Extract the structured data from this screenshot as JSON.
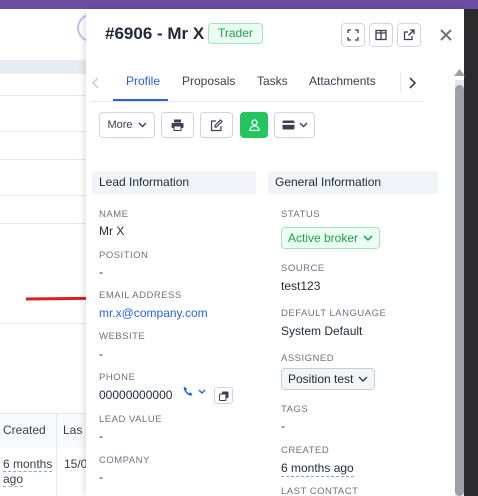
{
  "background": {
    "table_headers": [
      "Created",
      "Las"
    ],
    "created_cell": "6 months ago",
    "last_cell": "15/0"
  },
  "lead": {
    "title": "#6906 - Mr X",
    "badge": "Trader"
  },
  "tabs": [
    "Profile",
    "Proposals",
    "Tasks",
    "Attachments"
  ],
  "active_tab": "Profile",
  "toolbar": {
    "more_label": "More"
  },
  "sections": {
    "lead_information": "Lead Information",
    "general_information": "General Information"
  },
  "lead_info": {
    "name_label": "NAME",
    "name": "Mr X",
    "position_label": "POSITION",
    "position": "-",
    "email_label": "EMAIL ADDRESS",
    "email": "mr.x@company.com",
    "website_label": "WEBSITE",
    "website": "-",
    "phone_label": "PHONE",
    "phone": "00000000000",
    "lead_value_label": "LEAD VALUE",
    "lead_value": "-",
    "company_label": "COMPANY",
    "company": "-"
  },
  "general_info": {
    "status_label": "STATUS",
    "status": "Active broker",
    "source_label": "SOURCE",
    "source": "test123",
    "default_language_label": "DEFAULT LANGUAGE",
    "default_language": "System Default",
    "assigned_label": "ASSIGNED",
    "assigned": "Position test",
    "tags_label": "TAGS",
    "tags": "-",
    "created_label": "CREATED",
    "created": "6 months ago",
    "last_contact_label": "LAST CONTACT"
  },
  "colors": {
    "accent": "#2563eb",
    "success": "#22c55e",
    "annotation_arrow": "#e11d1d"
  }
}
